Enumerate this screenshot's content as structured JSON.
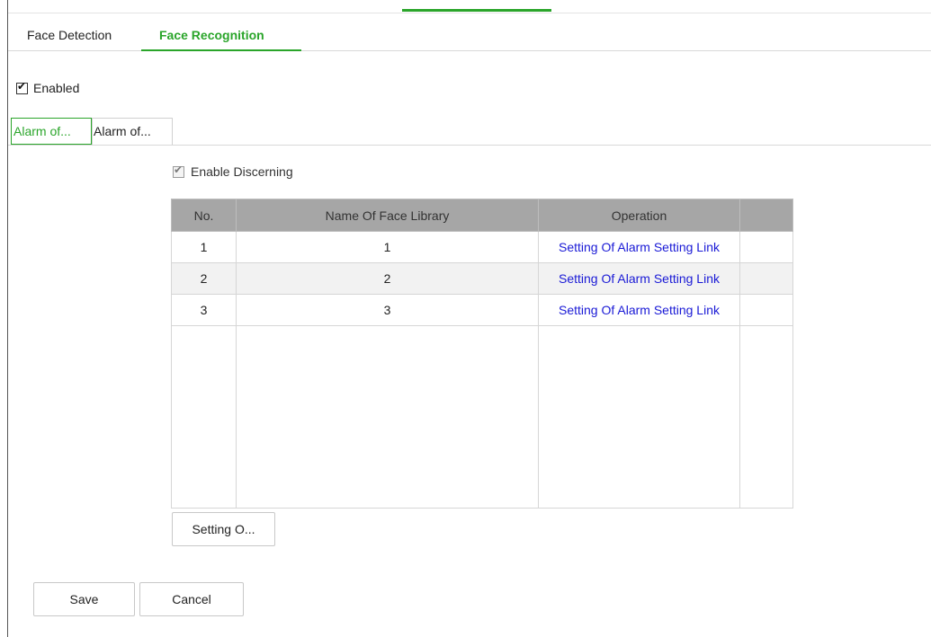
{
  "tabs": {
    "face_detection": "Face Detection",
    "face_recognition": "Face Recognition"
  },
  "enabled": {
    "label": "Enabled",
    "checked": true
  },
  "sub_tabs": [
    "Alarm of...",
    "Alarm of..."
  ],
  "discerning": {
    "label": "Enable Discerning",
    "checked": true
  },
  "table": {
    "headers": [
      "No.",
      "Name Of Face Library",
      "Operation",
      ""
    ],
    "rows": [
      {
        "no": "1",
        "name": "1",
        "operation": "Setting Of Alarm Setting Link"
      },
      {
        "no": "2",
        "name": "2",
        "operation": "Setting Of Alarm Setting Link"
      },
      {
        "no": "3",
        "name": "3",
        "operation": "Setting Of Alarm Setting Link"
      }
    ]
  },
  "buttons": {
    "setting": "Setting O...",
    "save": "Save",
    "cancel": "Cancel"
  },
  "colors": {
    "accent": "#2aa52a",
    "link": "#1a1ad6",
    "table_header": "#a6a6a6"
  },
  "icons": {
    "checkbox": "check-mark-icon"
  }
}
